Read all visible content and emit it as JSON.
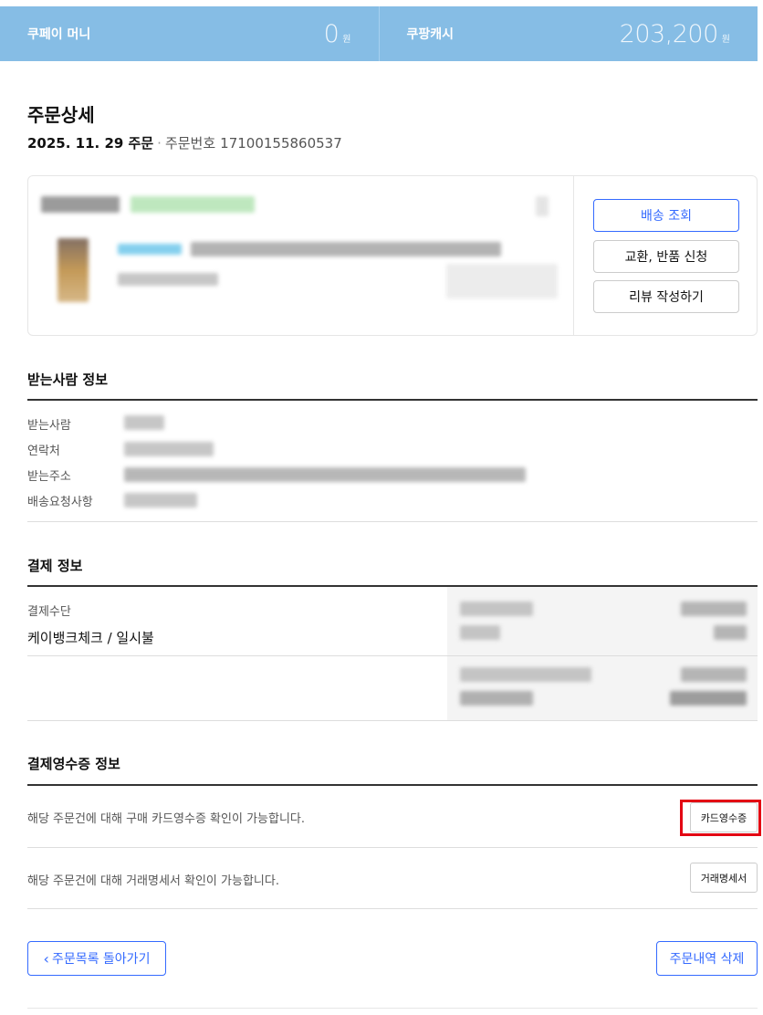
{
  "balances": {
    "coupay_money_label": "쿠페이 머니",
    "coupay_money_value": "0",
    "coupay_money_unit": "원",
    "coupang_cash_label": "쿠팡캐시",
    "coupang_cash_value": "203,200",
    "coupang_cash_unit": "원"
  },
  "page": {
    "title": "주문상세",
    "order_date": "2025. 11. 29 주문",
    "separator": "·",
    "order_number_label": "주문번호",
    "order_number": "17100155860537"
  },
  "product_card": {
    "track_button": "배송 조회",
    "return_button": "교환, 반품 신청",
    "review_button": "리뷰 작성하기"
  },
  "recipient": {
    "title": "받는사람 정보",
    "labels": [
      "받는사람",
      "연락처",
      "받는주소",
      "배송요청사항"
    ]
  },
  "payment": {
    "title": "결제 정보",
    "method_label": "결제수단",
    "method_value": "케이뱅크체크 / 일시불"
  },
  "receipt": {
    "title": "결제영수증 정보",
    "card_receipt_text": "해당 주문건에 대해 구매 카드영수증 확인이 가능합니다.",
    "card_receipt_button": "카드영수증",
    "statement_text": "해당 주문건에 대해 거래명세서 확인이 가능합니다.",
    "statement_button": "거래명세서"
  },
  "footer": {
    "back_button": "주문목록 돌아가기",
    "delete_button": "주문내역 삭제"
  },
  "colors": {
    "balance_bar": "#86bde5",
    "accent_blue": "#346aff",
    "highlight_red": "#e30613"
  }
}
